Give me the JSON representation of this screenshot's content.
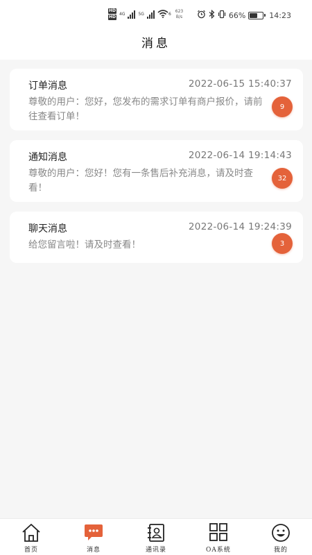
{
  "status_bar": {
    "hd_1": "HD",
    "hd_2": "HD",
    "net_4g": "4G",
    "net_5g": "5G",
    "wifi_badge": "6",
    "speed_value": "623",
    "speed_unit": "B/s",
    "battery_percent": "66%",
    "battery_level": 0.66,
    "time": "14:23"
  },
  "header": {
    "title": "消息"
  },
  "messages": [
    {
      "title": "订单消息",
      "time": "2022-06-15 15:40:37",
      "text": "尊敬的用户：您好，您发布的需求订单有商户报价，请前往查看订单！",
      "badge": "9"
    },
    {
      "title": "通知消息",
      "time": "2022-06-14 19:14:43",
      "text": "尊敬的用户：您好！您有一条售后补充消息，请及时查看！",
      "badge": "32"
    },
    {
      "title": "聊天消息",
      "time": "2022-06-14 19:24:39",
      "text": "给您留言啦！请及时查看！",
      "badge": "3"
    }
  ],
  "tabs": [
    {
      "label": "首页",
      "icon": "home-icon"
    },
    {
      "label": "消息",
      "icon": "chat-bubble-icon",
      "active": true
    },
    {
      "label": "通讯录",
      "icon": "contacts-icon"
    },
    {
      "label": "OA系统",
      "icon": "grid-apps-icon"
    },
    {
      "label": "我的",
      "icon": "smiley-icon"
    }
  ],
  "colors": {
    "accent": "#e4623a",
    "badge": "#e4623a",
    "background": "#f6f6f6",
    "card": "#ffffff"
  }
}
